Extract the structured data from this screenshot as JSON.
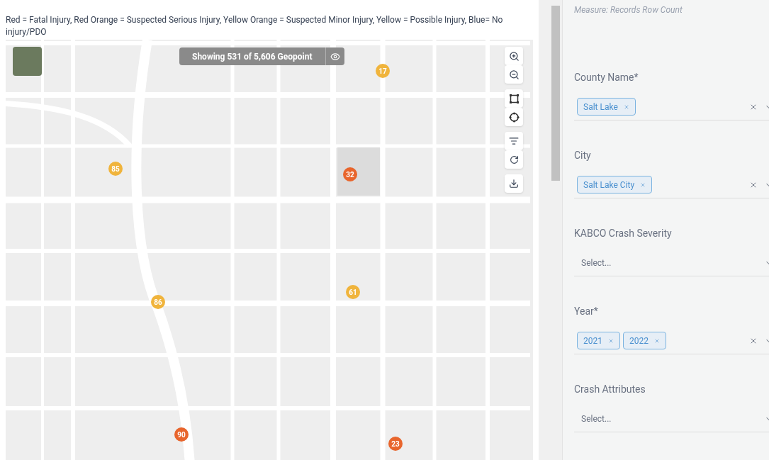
{
  "legend": "Red = Fatal Injury, Red Orange = Suspected Serious Injury, Yellow Orange = Suspected Minor Injury, Yellow = Possible Injury, Blue= No injury/PDO",
  "map": {
    "count_banner": "Showing 531 of 5,606 Geopoint",
    "clusters": [
      {
        "count": "17",
        "color": "#f0b43c"
      },
      {
        "count": "85",
        "color": "#f0b43c"
      },
      {
        "count": "32",
        "color": "#e8652c"
      },
      {
        "count": "86",
        "color": "#f0b43c"
      },
      {
        "count": "61",
        "color": "#f0b43c"
      },
      {
        "count": "90",
        "color": "#e8652c"
      },
      {
        "count": "23",
        "color": "#e8652c"
      }
    ]
  },
  "panel": {
    "measure": "Measure: Records Row Count",
    "filters": [
      {
        "label": "County Name*",
        "tags": [
          "Salt Lake"
        ]
      },
      {
        "label": "City",
        "tags": [
          "Salt Lake City"
        ]
      },
      {
        "label": "KABCO Crash Severity",
        "placeholder": "Select..."
      },
      {
        "label": "Year*",
        "tags": [
          "2021",
          "2022"
        ]
      },
      {
        "label": "Crash Attributes",
        "placeholder": "Select..."
      }
    ]
  }
}
